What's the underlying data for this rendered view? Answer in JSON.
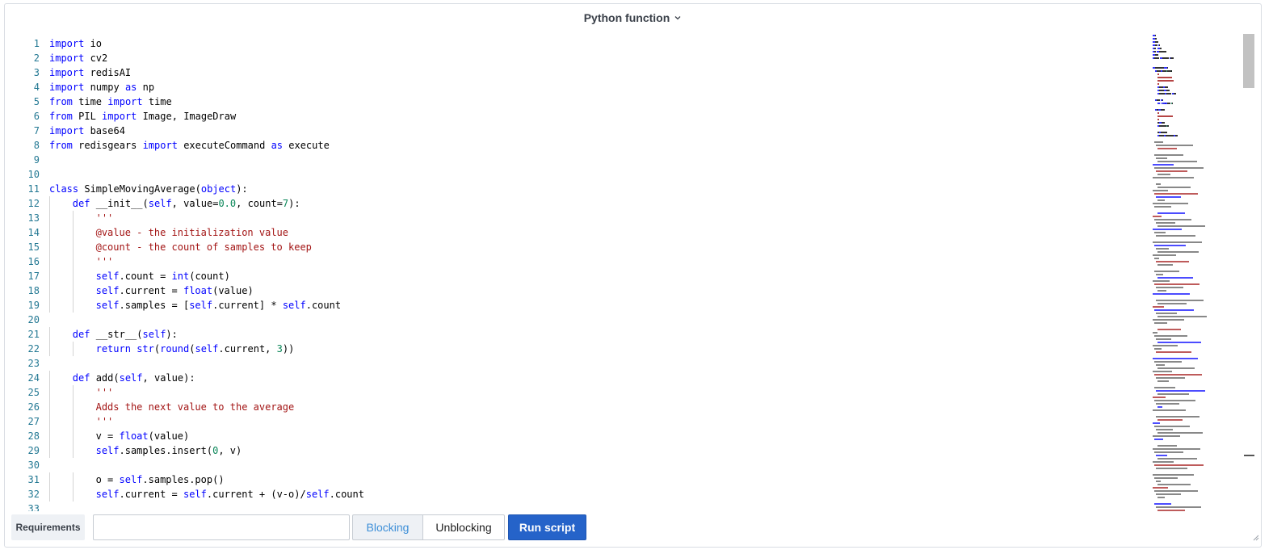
{
  "header": {
    "title": "Python function",
    "dropdown_icon": "chevron-down-icon"
  },
  "editor": {
    "lines": [
      {
        "n": "1",
        "indent": 0,
        "tokens": [
          [
            "keyword",
            "import"
          ],
          [
            "plain",
            " io"
          ]
        ]
      },
      {
        "n": "2",
        "indent": 0,
        "tokens": [
          [
            "keyword",
            "import"
          ],
          [
            "plain",
            " cv2"
          ]
        ]
      },
      {
        "n": "3",
        "indent": 0,
        "tokens": [
          [
            "keyword",
            "import"
          ],
          [
            "plain",
            " redisAI"
          ]
        ]
      },
      {
        "n": "4",
        "indent": 0,
        "tokens": [
          [
            "keyword",
            "import"
          ],
          [
            "plain",
            " numpy "
          ],
          [
            "keyword",
            "as"
          ],
          [
            "plain",
            " np"
          ]
        ]
      },
      {
        "n": "5",
        "indent": 0,
        "tokens": [
          [
            "keyword",
            "from"
          ],
          [
            "plain",
            " time "
          ],
          [
            "keyword",
            "import"
          ],
          [
            "plain",
            " time"
          ]
        ]
      },
      {
        "n": "6",
        "indent": 0,
        "tokens": [
          [
            "keyword",
            "from"
          ],
          [
            "plain",
            " PIL "
          ],
          [
            "keyword",
            "import"
          ],
          [
            "plain",
            " Image, ImageDraw"
          ]
        ]
      },
      {
        "n": "7",
        "indent": 0,
        "tokens": [
          [
            "keyword",
            "import"
          ],
          [
            "plain",
            " base64"
          ]
        ]
      },
      {
        "n": "8",
        "indent": 0,
        "tokens": [
          [
            "keyword",
            "from"
          ],
          [
            "plain",
            " redisgears "
          ],
          [
            "keyword",
            "import"
          ],
          [
            "plain",
            " executeCommand "
          ],
          [
            "keyword",
            "as"
          ],
          [
            "plain",
            " execute"
          ]
        ]
      },
      {
        "n": "9",
        "indent": 0,
        "tokens": []
      },
      {
        "n": "10",
        "indent": 0,
        "tokens": []
      },
      {
        "n": "11",
        "indent": 0,
        "tokens": [
          [
            "keyword",
            "class"
          ],
          [
            "plain",
            " SimpleMovingAverage("
          ],
          [
            "keyword",
            "object"
          ],
          [
            "plain",
            "):"
          ]
        ]
      },
      {
        "n": "12",
        "indent": 1,
        "tokens": [
          [
            "keyword",
            "def"
          ],
          [
            "plain",
            " __init__("
          ],
          [
            "keyword",
            "self"
          ],
          [
            "plain",
            ", value="
          ],
          [
            "number",
            "0.0"
          ],
          [
            "plain",
            ", count="
          ],
          [
            "number",
            "7"
          ],
          [
            "plain",
            "):"
          ]
        ]
      },
      {
        "n": "13",
        "indent": 2,
        "tokens": [
          [
            "string",
            "'''"
          ]
        ]
      },
      {
        "n": "14",
        "indent": 2,
        "tokens": [
          [
            "string",
            "@value - the initialization value"
          ]
        ]
      },
      {
        "n": "15",
        "indent": 2,
        "tokens": [
          [
            "string",
            "@count - the count of samples to keep"
          ]
        ]
      },
      {
        "n": "16",
        "indent": 2,
        "tokens": [
          [
            "string",
            "'''"
          ]
        ]
      },
      {
        "n": "17",
        "indent": 2,
        "tokens": [
          [
            "keyword",
            "self"
          ],
          [
            "plain",
            ".count = "
          ],
          [
            "keyword",
            "int"
          ],
          [
            "plain",
            "(count)"
          ]
        ]
      },
      {
        "n": "18",
        "indent": 2,
        "tokens": [
          [
            "keyword",
            "self"
          ],
          [
            "plain",
            ".current = "
          ],
          [
            "keyword",
            "float"
          ],
          [
            "plain",
            "(value)"
          ]
        ]
      },
      {
        "n": "19",
        "indent": 2,
        "tokens": [
          [
            "keyword",
            "self"
          ],
          [
            "plain",
            ".samples = ["
          ],
          [
            "keyword",
            "self"
          ],
          [
            "plain",
            ".current] * "
          ],
          [
            "keyword",
            "self"
          ],
          [
            "plain",
            ".count"
          ]
        ]
      },
      {
        "n": "20",
        "indent": 0,
        "tokens": []
      },
      {
        "n": "21",
        "indent": 1,
        "tokens": [
          [
            "keyword",
            "def"
          ],
          [
            "plain",
            " __str__("
          ],
          [
            "keyword",
            "self"
          ],
          [
            "plain",
            "):"
          ]
        ]
      },
      {
        "n": "22",
        "indent": 2,
        "tokens": [
          [
            "keyword",
            "return"
          ],
          [
            "plain",
            " "
          ],
          [
            "keyword",
            "str"
          ],
          [
            "plain",
            "("
          ],
          [
            "keyword",
            "round"
          ],
          [
            "plain",
            "("
          ],
          [
            "keyword",
            "self"
          ],
          [
            "plain",
            ".current, "
          ],
          [
            "number",
            "3"
          ],
          [
            "plain",
            "))"
          ]
        ]
      },
      {
        "n": "23",
        "indent": 0,
        "tokens": []
      },
      {
        "n": "24",
        "indent": 1,
        "tokens": [
          [
            "keyword",
            "def"
          ],
          [
            "plain",
            " add("
          ],
          [
            "keyword",
            "self"
          ],
          [
            "plain",
            ", value):"
          ]
        ]
      },
      {
        "n": "25",
        "indent": 2,
        "tokens": [
          [
            "string",
            "'''"
          ]
        ]
      },
      {
        "n": "26",
        "indent": 2,
        "tokens": [
          [
            "string",
            "Adds the next value to the average"
          ]
        ]
      },
      {
        "n": "27",
        "indent": 2,
        "tokens": [
          [
            "string",
            "'''"
          ]
        ]
      },
      {
        "n": "28",
        "indent": 2,
        "tokens": [
          [
            "plain",
            "v = "
          ],
          [
            "keyword",
            "float"
          ],
          [
            "plain",
            "(value)"
          ]
        ]
      },
      {
        "n": "29",
        "indent": 2,
        "tokens": [
          [
            "keyword",
            "self"
          ],
          [
            "plain",
            ".samples.insert("
          ],
          [
            "number",
            "0"
          ],
          [
            "plain",
            ", v)"
          ]
        ]
      },
      {
        "n": "30",
        "indent": 0,
        "tokens": []
      },
      {
        "n": "31",
        "indent": 2,
        "tokens": [
          [
            "plain",
            "o = "
          ],
          [
            "keyword",
            "self"
          ],
          [
            "plain",
            ".samples.pop()"
          ]
        ]
      },
      {
        "n": "32",
        "indent": 2,
        "tokens": [
          [
            "keyword",
            "self"
          ],
          [
            "plain",
            ".current = "
          ],
          [
            "keyword",
            "self"
          ],
          [
            "plain",
            ".current + (v-o)/"
          ],
          [
            "keyword",
            "self"
          ],
          [
            "plain",
            ".count"
          ]
        ]
      },
      {
        "n": "33",
        "indent": 0,
        "tokens": []
      }
    ]
  },
  "colors": {
    "keyword": "#0000ff",
    "string": "#a31515",
    "number": "#098658",
    "plain": "#000000",
    "line_number": "#237893",
    "accent": "#2563c9",
    "active_segment_text": "#3d8fd8"
  },
  "footer": {
    "requirements_label": "Requirements",
    "requirements_value": "",
    "requirements_placeholder": "",
    "mode_options": [
      "Blocking",
      "Unblocking"
    ],
    "selected_mode": "Blocking",
    "blocking_label": "Blocking",
    "unblocking_label": "Unblocking",
    "run_label": "Run script"
  }
}
